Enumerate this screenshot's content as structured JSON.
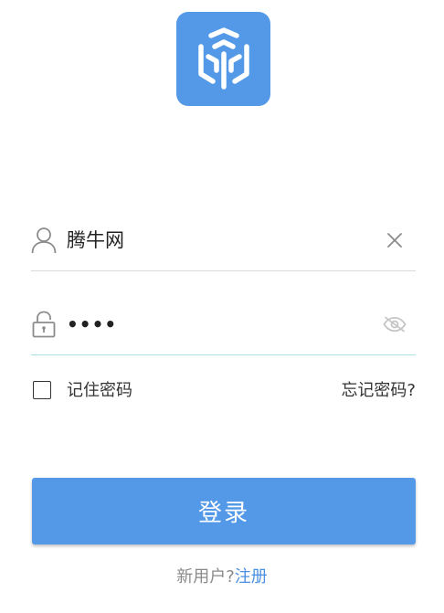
{
  "app": {
    "logo_icon": "cube-logo-icon",
    "brand_color": "#5499e8"
  },
  "username": {
    "icon": "user-icon",
    "value": "腾牛网",
    "clear_icon": "close-icon"
  },
  "password": {
    "icon": "lock-icon",
    "masked_value": "••••",
    "toggle_icon": "eye-off-icon"
  },
  "options": {
    "remember_label": "记住密码",
    "remember_checked": false,
    "forgot_label": "忘记密码?"
  },
  "login_button": {
    "label": "登录"
  },
  "register": {
    "prompt": "新用户?",
    "link_label": "注册"
  }
}
